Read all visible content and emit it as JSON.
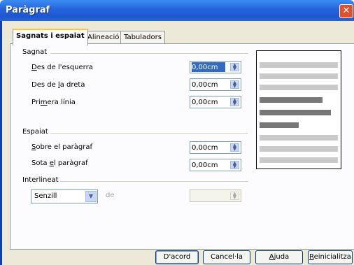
{
  "window": {
    "title": "Paràgraf"
  },
  "tabs": [
    {
      "label": "Sagnats i espaiat"
    },
    {
      "label": "Alineació"
    },
    {
      "label": "Tabuladors"
    }
  ],
  "sagnat": {
    "heading": "Sagnat",
    "left": {
      "label": "Des de l'esquerra",
      "value": "0,00cm"
    },
    "right": {
      "label": "Des de la dreta",
      "value": "0,00cm"
    },
    "first": {
      "label": "Primera línia",
      "value": "0,00cm"
    }
  },
  "espaiat": {
    "heading": "Espaiat",
    "above": {
      "label": "Sobre el paràgraf",
      "value": "0,00cm"
    },
    "below": {
      "label": "Sota el paràgraf",
      "value": "0,00cm"
    }
  },
  "interlineat": {
    "heading": "Interlineat",
    "selected": "Senzill",
    "de_label": "de",
    "value": ""
  },
  "buttons": {
    "ok": "D'acord",
    "cancel": "Cancel·la",
    "help": "Ajuda",
    "reset": "Reinicialitza"
  }
}
